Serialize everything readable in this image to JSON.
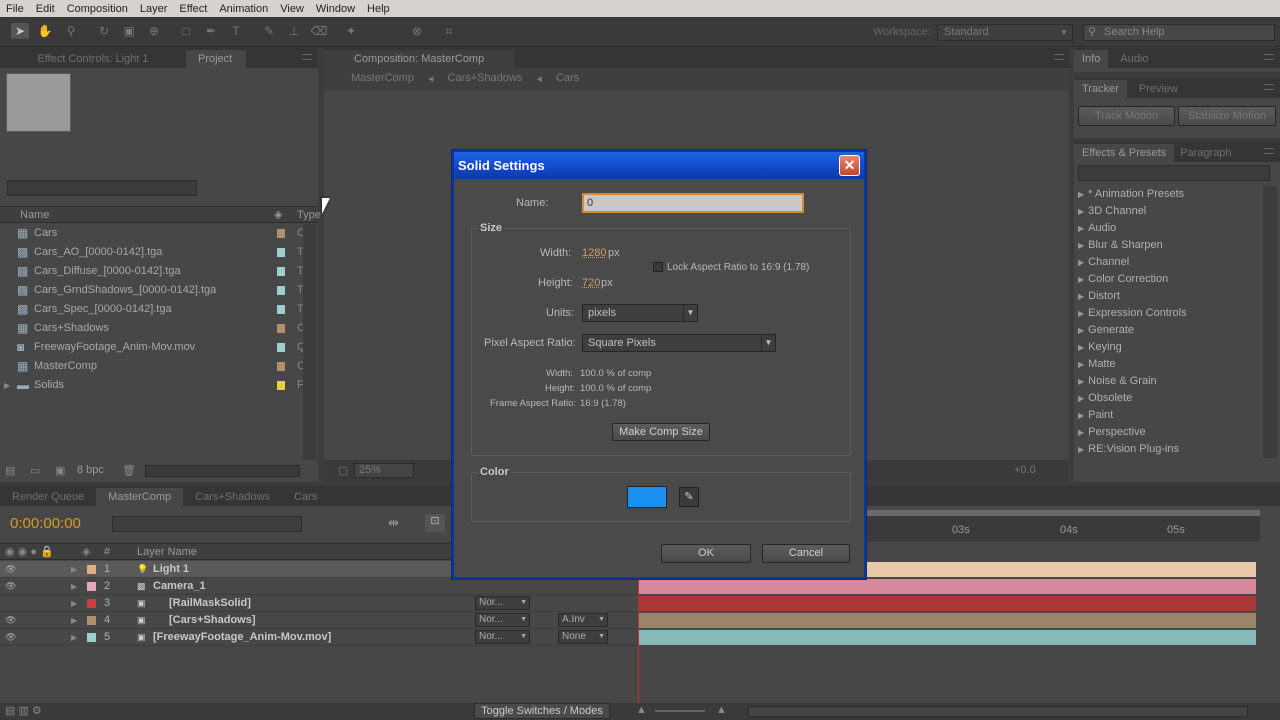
{
  "menubar": [
    "File",
    "Edit",
    "Composition",
    "Layer",
    "Effect",
    "Animation",
    "View",
    "Window",
    "Help"
  ],
  "toolbar": {
    "workspace_label": "Workspace:",
    "workspace_value": "Standard",
    "search_placeholder": "Search Help"
  },
  "left_panel": {
    "tabs": [
      "Effect Controls: Light 1",
      "Project"
    ],
    "columns": {
      "name": "Name",
      "type": "Type"
    },
    "items": [
      {
        "name": "Cars",
        "type": "C",
        "color": "#b09070",
        "icon": "comp"
      },
      {
        "name": "Cars_AO_[0000-0142].tga",
        "type": "T",
        "color": "#9dcfcf",
        "icon": "footage"
      },
      {
        "name": "Cars_Diffuse_[0000-0142].tga",
        "type": "T",
        "color": "#9dcfcf",
        "icon": "footage"
      },
      {
        "name": "Cars_GrndShadows_[0000-0142].tga",
        "type": "T",
        "color": "#9dcfcf",
        "icon": "footage"
      },
      {
        "name": "Cars_Spec_[0000-0142].tga",
        "type": "T",
        "color": "#9dcfcf",
        "icon": "footage"
      },
      {
        "name": "Cars+Shadows",
        "type": "C",
        "color": "#b09070",
        "icon": "comp"
      },
      {
        "name": "FreewayFootage_Anim-Mov.mov",
        "type": "Q",
        "color": "#9dcfcf",
        "icon": "movie"
      },
      {
        "name": "MasterComp",
        "type": "C",
        "color": "#b09070",
        "icon": "comp"
      },
      {
        "name": "Solids",
        "type": "F",
        "color": "#e8d040",
        "icon": "folder"
      }
    ],
    "footer_bpc": "8 bpc"
  },
  "comp_panel": {
    "tab": "Composition: MasterComp",
    "breadcrumbs": [
      "MasterComp",
      "Cars+Shadows",
      "Cars"
    ],
    "zoom": "25%",
    "time_offset": "+0.0"
  },
  "right_panels": {
    "top_tabs": [
      "Info",
      "Audio"
    ],
    "mid_tabs": [
      "Tracker",
      "Preview"
    ],
    "track_motion": "Track Motion",
    "stabilize_motion": "Stabilize Motion",
    "effects_tabs": [
      "Effects & Presets",
      "Paragraph"
    ],
    "effects": [
      "* Animation Presets",
      "3D Channel",
      "Audio",
      "Blur & Sharpen",
      "Channel",
      "Color Correction",
      "Distort",
      "Expression Controls",
      "Generate",
      "Keying",
      "Matte",
      "Noise & Grain",
      "Obsolete",
      "Paint",
      "Perspective",
      "RE:Vision Plug-ins"
    ]
  },
  "timeline": {
    "tabs": [
      "Render Queue",
      "MasterComp",
      "Cars+Shadows",
      "Cars"
    ],
    "timecode": "0:00:00:00",
    "col_num": "#",
    "col_layer": "Layer Name",
    "ticks": [
      "03s",
      "04s",
      "05s"
    ],
    "layers": [
      {
        "num": "1",
        "name": "Light 1",
        "color": "#e0b080",
        "bar": "#e8c8a8",
        "mode": "",
        "trkmat": ""
      },
      {
        "num": "2",
        "name": "Camera_1",
        "color": "#e0a8c0",
        "bar": "#d88a9c",
        "mode": "",
        "trkmat": ""
      },
      {
        "num": "3",
        "name": "[RailMaskSolid]",
        "color": "#c84040",
        "bar": "#a83838",
        "mode": "Nor...",
        "trkmat": ""
      },
      {
        "num": "4",
        "name": "[Cars+Shadows]",
        "color": "#b09070",
        "bar": "#9c8468",
        "mode": "Nor...",
        "trkmat": "A.Inv"
      },
      {
        "num": "5",
        "name": "[FreewayFootage_Anim-Mov.mov]",
        "color": "#9dcfcf",
        "bar": "#88b8b8",
        "mode": "Nor...",
        "trkmat": "None"
      }
    ],
    "toggle_label": "Toggle Switches / Modes"
  },
  "dialog": {
    "title": "Solid Settings",
    "name_label": "Name:",
    "name_value": "0",
    "size_label": "Size",
    "width_label": "Width:",
    "width_value": "1280",
    "width_unit": "px",
    "height_label": "Height:",
    "height_value": "720",
    "height_unit": "px",
    "lock_label": "Lock Aspect Ratio to 16:9 (1.78)",
    "units_label": "Units:",
    "units_value": "pixels",
    "par_label": "Pixel Aspect Ratio:",
    "par_value": "Square Pixels",
    "info_width_label": "Width:",
    "info_width_value": "100.0 % of comp",
    "info_height_label": "Height:",
    "info_height_value": "100.0 % of comp",
    "info_far_label": "Frame Aspect Ratio:",
    "info_far_value": "16:9 (1.78)",
    "make_comp_size": "Make Comp Size",
    "color_label": "Color",
    "swatch_color": "#1a90f0",
    "ok": "OK",
    "cancel": "Cancel"
  }
}
